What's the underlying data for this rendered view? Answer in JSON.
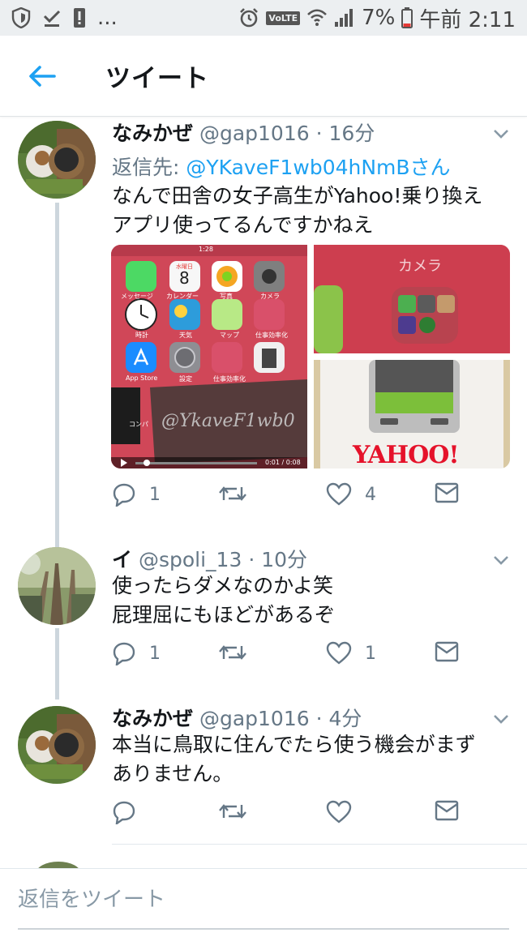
{
  "status_bar": {
    "icons_left": [
      "shield-icon",
      "checkmark-icon",
      "alert-icon"
    ],
    "overflow": "...",
    "icons_right": [
      "alarm-icon",
      "volte-icon",
      "wifi-icon",
      "signal-icon",
      "battery-icon"
    ],
    "volte_label": "VoLTE",
    "battery": "7%",
    "time": "午前 2:11"
  },
  "header": {
    "title": "ツイート",
    "back_icon": "arrow-left-icon"
  },
  "colors": {
    "accent": "#1da1f2",
    "secondary_text": "#657786",
    "thread_line": "#cdd6dd"
  },
  "tweets": [
    {
      "name": "なみかぜ",
      "handle": "@gap1016",
      "time": "16分",
      "reply_prefix": "返信先: ",
      "reply_to": "@YKaveF1wb04hNmBさん",
      "text": [
        "なんで田舎の女子高生がYahoo!乗り換え",
        "アプリ使ってるんですかねえ"
      ],
      "media": {
        "video": {
          "phone_time": "1:28",
          "apps": [
            "メッセージ",
            "カレンダー",
            "写真",
            "カメラ",
            "時計",
            "天気",
            "マップ",
            "仕事効率化",
            "App Store",
            "設定",
            "仕事効率化",
            "コンパ"
          ],
          "calendar_day": "8",
          "calendar_weekday": "水曜日",
          "watermark": "@YkaveF1wb0",
          "timecode": "0:01 / 0:08"
        },
        "camera_label": "カメラ",
        "yahoo_logo": "YAHOO!"
      },
      "replies": "1",
      "retweets": "",
      "likes": "4"
    },
    {
      "name": "イ",
      "handle": "@spoli_13",
      "time": "10分",
      "text": [
        "使ったらダメなのかよ笑",
        "屁理屈にもほどがあるぞ"
      ],
      "replies": "1",
      "retweets": "",
      "likes": "1"
    },
    {
      "name": "なみかぜ",
      "handle": "@gap1016",
      "time": "4分",
      "text": [
        "本当に鳥取に住んでたら使う機会がまず",
        "ありません。"
      ],
      "replies": "",
      "retweets": "",
      "likes": ""
    }
  ],
  "compose": {
    "placeholder": "返信をツイート"
  }
}
